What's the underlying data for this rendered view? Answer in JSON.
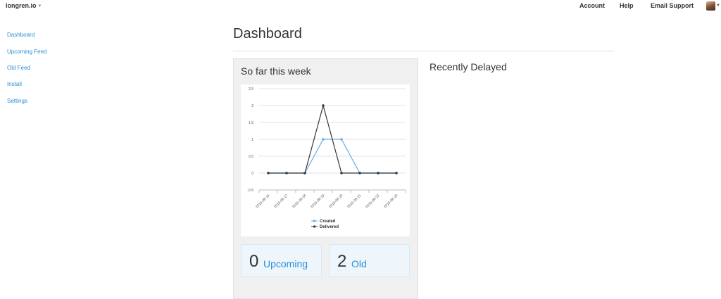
{
  "topbar": {
    "brand": "longren.io",
    "nav": [
      {
        "label": "Account"
      },
      {
        "label": "Help"
      },
      {
        "label": "Email Support"
      }
    ]
  },
  "sidebar": {
    "items": [
      {
        "label": "Dashboard"
      },
      {
        "label": "Upcoming Feed"
      },
      {
        "label": "Old Feed"
      },
      {
        "label": "Install"
      },
      {
        "label": "Settings"
      }
    ]
  },
  "main": {
    "title": "Dashboard",
    "week_panel": {
      "title": "So far this week"
    },
    "stats": [
      {
        "count": "0",
        "label": "Upcoming"
      },
      {
        "count": "2",
        "label": "Old"
      }
    ],
    "recently_delayed": {
      "title": "Recently Delayed"
    }
  },
  "colors": {
    "link": "#2a8fd6",
    "created": "#6aaee8",
    "delivered": "#333333"
  },
  "chart_data": {
    "type": "line",
    "x": [
      "2015-08-16",
      "2015-08-17",
      "2015-08-18",
      "2015-08-19",
      "2015-08-20",
      "2015-08-21",
      "2015-08-22",
      "2015-08-23"
    ],
    "y_ticks": [
      "2.5",
      "2",
      "1.5",
      "1",
      "0.5",
      "0",
      "-0.5"
    ],
    "ylim": [
      -0.5,
      2.5
    ],
    "grid": true,
    "legend": "bottom",
    "series": [
      {
        "name": "Created",
        "values": [
          0,
          0,
          0,
          1,
          1,
          0,
          0,
          0
        ],
        "color": "#6aaee8"
      },
      {
        "name": "Delivered",
        "values": [
          0,
          0,
          0,
          2,
          0,
          0,
          0,
          0
        ],
        "color": "#333333"
      }
    ]
  }
}
